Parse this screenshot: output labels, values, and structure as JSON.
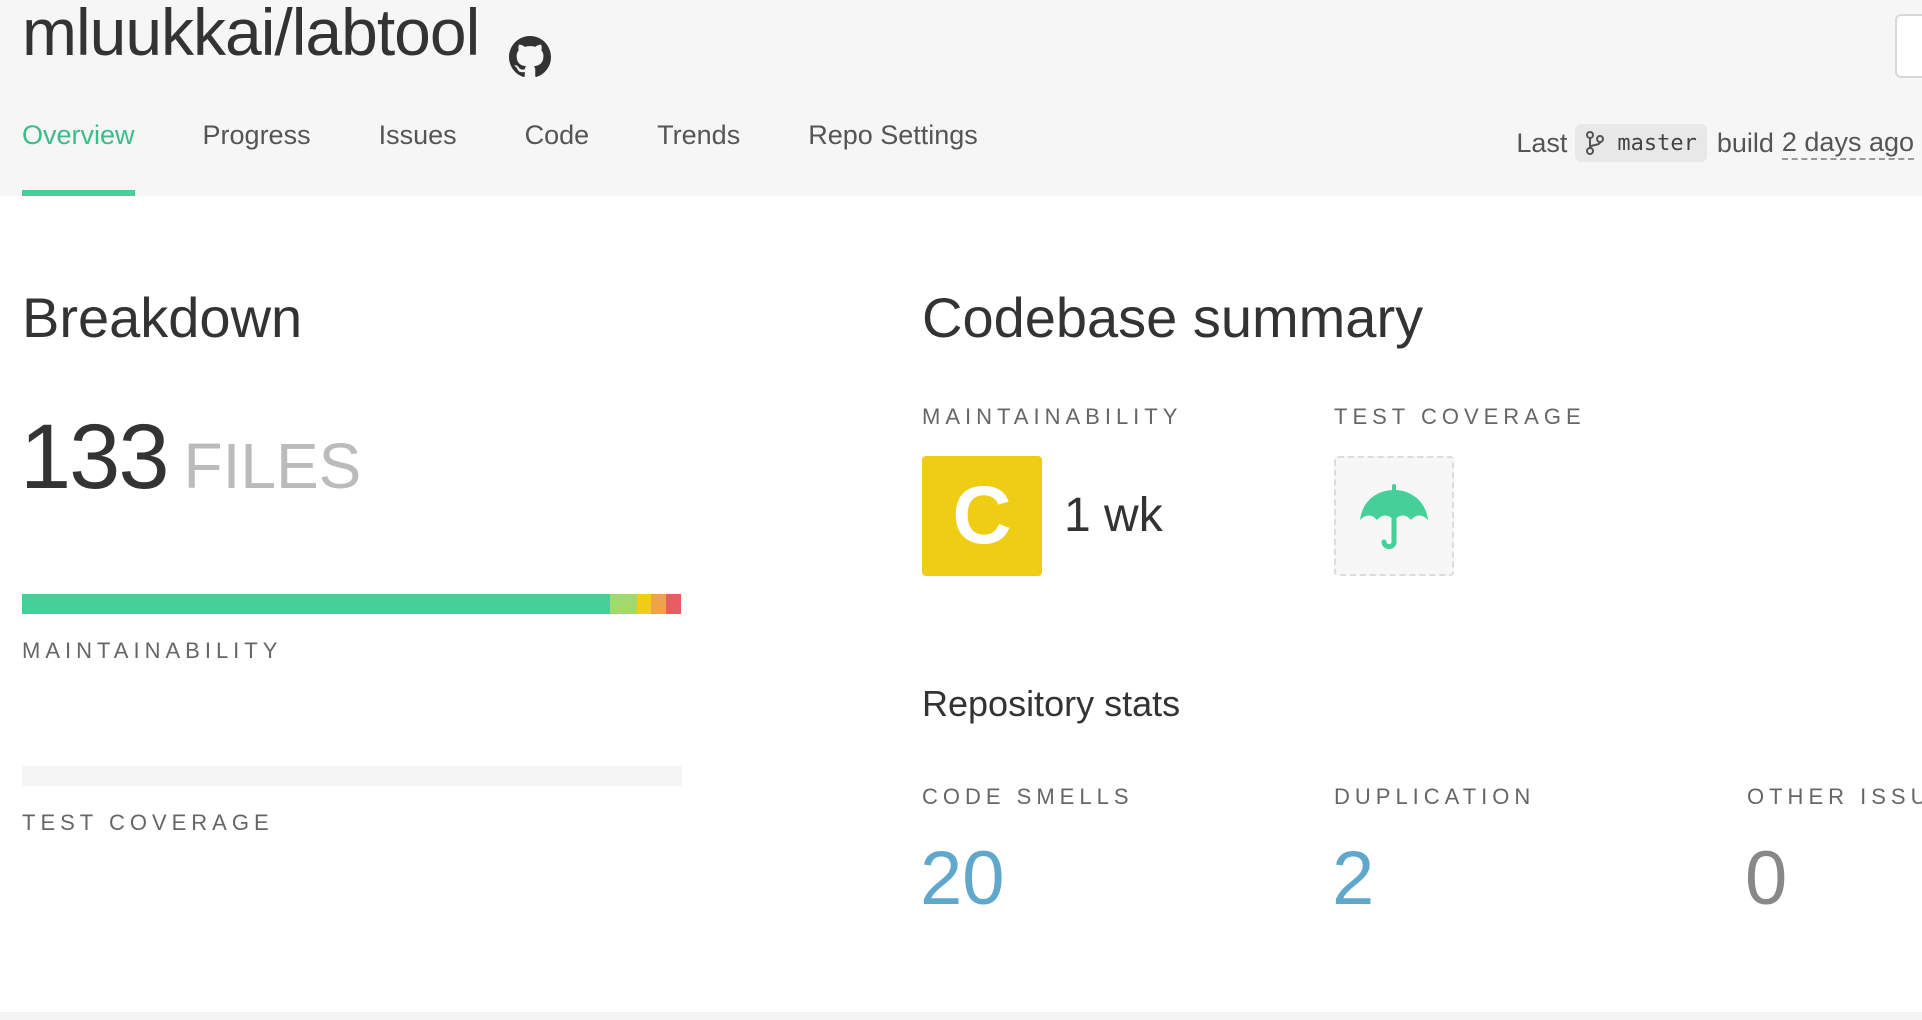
{
  "header": {
    "repo_name": "mluukkai/labtool",
    "tabs": [
      {
        "label": "Overview",
        "active": true
      },
      {
        "label": "Progress",
        "active": false
      },
      {
        "label": "Issues",
        "active": false
      },
      {
        "label": "Code",
        "active": false
      },
      {
        "label": "Trends",
        "active": false
      },
      {
        "label": "Repo Settings",
        "active": false
      }
    ],
    "last_build": {
      "prefix": "Last",
      "branch": "master",
      "middle": "build",
      "time": "2 days ago"
    }
  },
  "breakdown": {
    "title": "Breakdown",
    "file_count": "133",
    "file_label": "FILES",
    "maintainability_label": "MAINTAINABILITY",
    "maintainability_segments": [
      {
        "grade": "A",
        "fraction": 0.892,
        "color": "#45d09a"
      },
      {
        "grade": "B",
        "fraction": 0.041,
        "color": "#a3d86a"
      },
      {
        "grade": "C",
        "fraction": 0.022,
        "color": "#eecd14"
      },
      {
        "grade": "D",
        "fraction": 0.022,
        "color": "#f0a24a"
      },
      {
        "grade": "F",
        "fraction": 0.023,
        "color": "#e85c63"
      }
    ],
    "test_coverage_label": "TEST COVERAGE"
  },
  "summary": {
    "title": "Codebase summary",
    "maintainability_label": "MAINTAINABILITY",
    "grade": "C",
    "grade_color": "#eecd14",
    "technical_debt": "1 wk",
    "test_coverage_label": "TEST COVERAGE",
    "coverage_icon": "umbrella-icon",
    "repo_stats_title": "Repository stats",
    "stats": [
      {
        "label": "CODE SMELLS",
        "value": "20",
        "color": "#5fa8cc"
      },
      {
        "label": "DUPLICATION",
        "value": "2",
        "color": "#5fa8cc"
      },
      {
        "label": "OTHER ISSUES",
        "value": "0",
        "color": "#888888"
      }
    ]
  },
  "colors": {
    "accent": "#45d09a",
    "header_bg": "#f6f6f6"
  }
}
